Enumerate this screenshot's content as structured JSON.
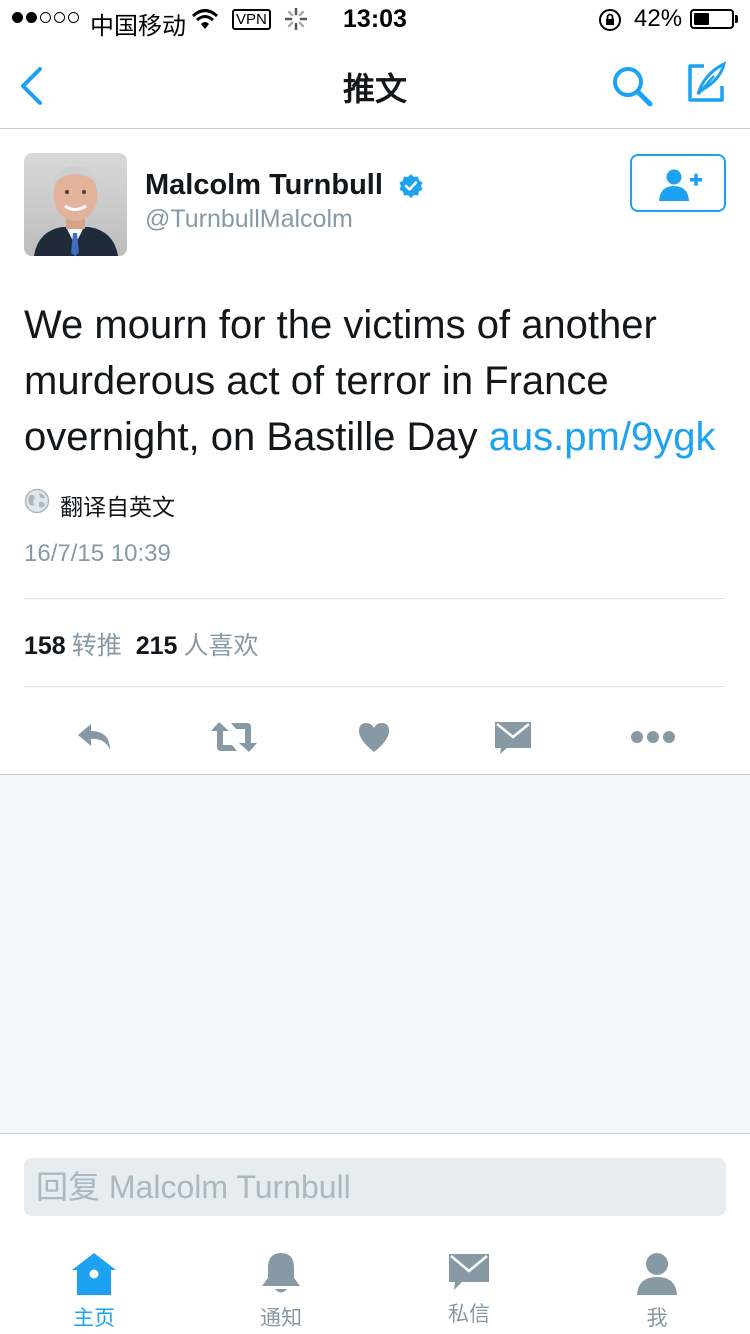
{
  "status_bar": {
    "carrier": "中国移动",
    "vpn": "VPN",
    "time": "13:03",
    "battery": "42%",
    "battery_level": 0.42
  },
  "nav": {
    "title": "推文",
    "back_icon": "chevron-left-icon",
    "search_icon": "search-icon",
    "compose_icon": "compose-icon"
  },
  "tweet": {
    "author_name": "Malcolm Turnbull",
    "author_handle": "@TurnbullMalcolm",
    "text": "We mourn for the victims of another murderous act of terror in France overnight, on Bastille Day ",
    "link": "aus.pm/9ygk",
    "translate_label": "翻译自英文",
    "timestamp": "16/7/15 10:39",
    "retweet_count": "158",
    "retweet_label": "转推",
    "like_count": "215",
    "like_label": "人喜欢"
  },
  "reply": {
    "placeholder": "回复 Malcolm Turnbull"
  },
  "tabs": [
    {
      "label": "主页",
      "icon": "home-icon",
      "active": true
    },
    {
      "label": "通知",
      "icon": "bell-icon",
      "active": false
    },
    {
      "label": "私信",
      "icon": "mail-icon",
      "active": false
    },
    {
      "label": "我",
      "icon": "profile-icon",
      "active": false
    }
  ],
  "colors": {
    "accent": "#1da1f2",
    "text": "#14171a",
    "muted": "#8899a6",
    "background_gray": "#f5f8fa"
  }
}
